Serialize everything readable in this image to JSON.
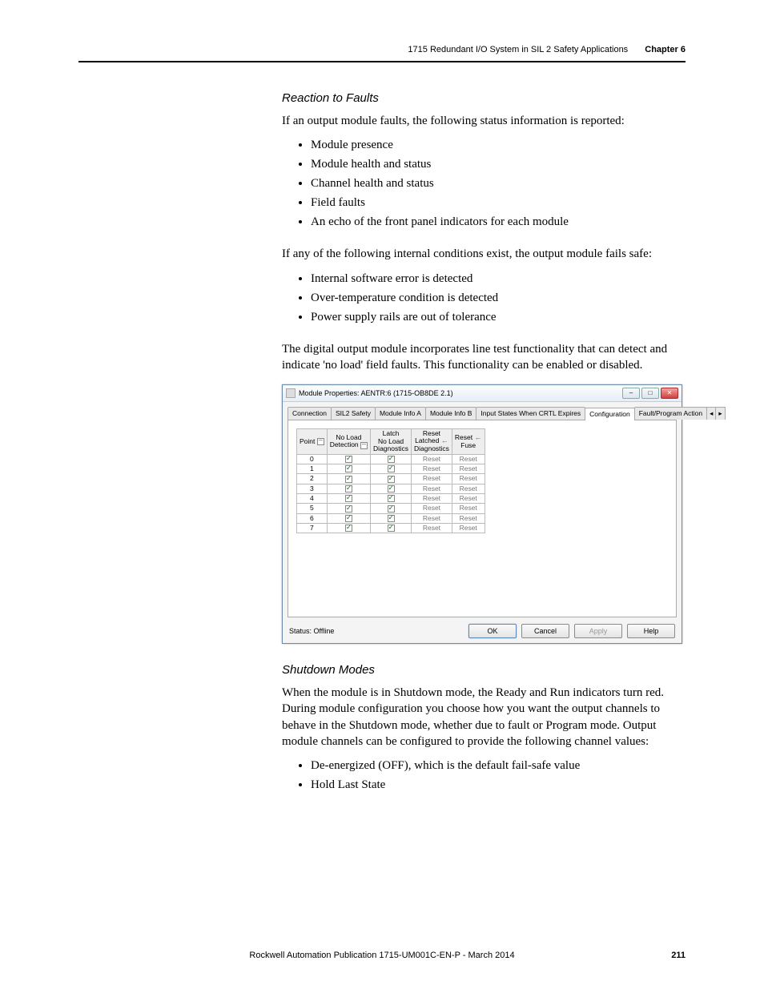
{
  "header": {
    "text": "1715 Redundant I/O System in SIL 2 Safety Applications",
    "chapter": "Chapter 6"
  },
  "section1": {
    "heading": "Reaction to Faults",
    "p1": "If an output module faults, the following status information is reported:",
    "list1": [
      "Module presence",
      "Module health and status",
      "Channel health and status",
      "Field faults",
      "An echo of the front panel indicators for each module"
    ],
    "p2": "If any of the following internal conditions exist, the output module fails safe:",
    "list2": [
      "Internal software error is detected",
      "Over-temperature condition is detected",
      "Power supply rails are out of tolerance"
    ],
    "p3": "The digital output module incorporates line test functionality that can detect and indicate 'no load' field faults. This functionality can be enabled or disabled."
  },
  "dialog": {
    "title": "Module Properties: AENTR:6 (1715-OB8DE 2.1)",
    "tabs": [
      "Connection",
      "SIL2 Safety",
      "Module Info A",
      "Module Info B",
      "Input States When CRTL Expires",
      "Configuration",
      "Fault/Program Action"
    ],
    "activeTab": "Configuration",
    "columns": {
      "point": "Point",
      "noLoad": "No Load\nDetection",
      "latch": "Latch\nNo Load\nDiagnostics",
      "resetLatched": "Reset\nLatched\nDiagnostics",
      "resetFuse": "Reset\nFuse"
    },
    "rows": [
      {
        "point": "0",
        "noLoad": true,
        "latch": true,
        "resetLatched": "Reset",
        "resetFuse": "Reset"
      },
      {
        "point": "1",
        "noLoad": true,
        "latch": true,
        "resetLatched": "Reset",
        "resetFuse": "Reset"
      },
      {
        "point": "2",
        "noLoad": true,
        "latch": true,
        "resetLatched": "Reset",
        "resetFuse": "Reset"
      },
      {
        "point": "3",
        "noLoad": true,
        "latch": true,
        "resetLatched": "Reset",
        "resetFuse": "Reset"
      },
      {
        "point": "4",
        "noLoad": true,
        "latch": true,
        "resetLatched": "Reset",
        "resetFuse": "Reset"
      },
      {
        "point": "5",
        "noLoad": true,
        "latch": true,
        "resetLatched": "Reset",
        "resetFuse": "Reset"
      },
      {
        "point": "6",
        "noLoad": true,
        "latch": true,
        "resetLatched": "Reset",
        "resetFuse": "Reset"
      },
      {
        "point": "7",
        "noLoad": true,
        "latch": true,
        "resetLatched": "Reset",
        "resetFuse": "Reset"
      }
    ],
    "status": "Status: Offline",
    "buttons": {
      "ok": "OK",
      "cancel": "Cancel",
      "apply": "Apply",
      "help": "Help"
    }
  },
  "section2": {
    "heading": "Shutdown Modes",
    "p1": "When the module is in Shutdown mode, the Ready and Run indicators turn red. During module configuration you choose how you want the output channels to behave in the Shutdown mode, whether due to fault or Program mode. Output module channels can be configured to provide the following channel values:",
    "list1": [
      "De-energized (OFF), which is the default fail-safe value",
      "Hold Last State"
    ]
  },
  "footer": {
    "text": "Rockwell Automation Publication 1715-UM001C-EN-P - March 2014",
    "page": "211"
  }
}
